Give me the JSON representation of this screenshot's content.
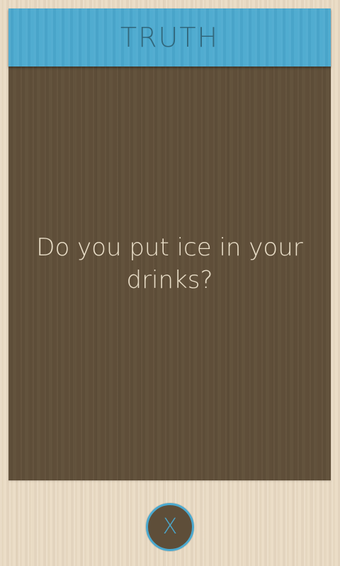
{
  "card": {
    "title": "TRUTH",
    "question": "Do you put ice in your drinks?"
  },
  "close_button": {
    "label": "X"
  },
  "colors": {
    "header": "#4ba9cf",
    "header_text": "#2c5b6d",
    "card_body": "#61503a",
    "question_text": "#eadfc9",
    "page_background": "#eadbc4",
    "close_accent": "#4ba9cf"
  }
}
